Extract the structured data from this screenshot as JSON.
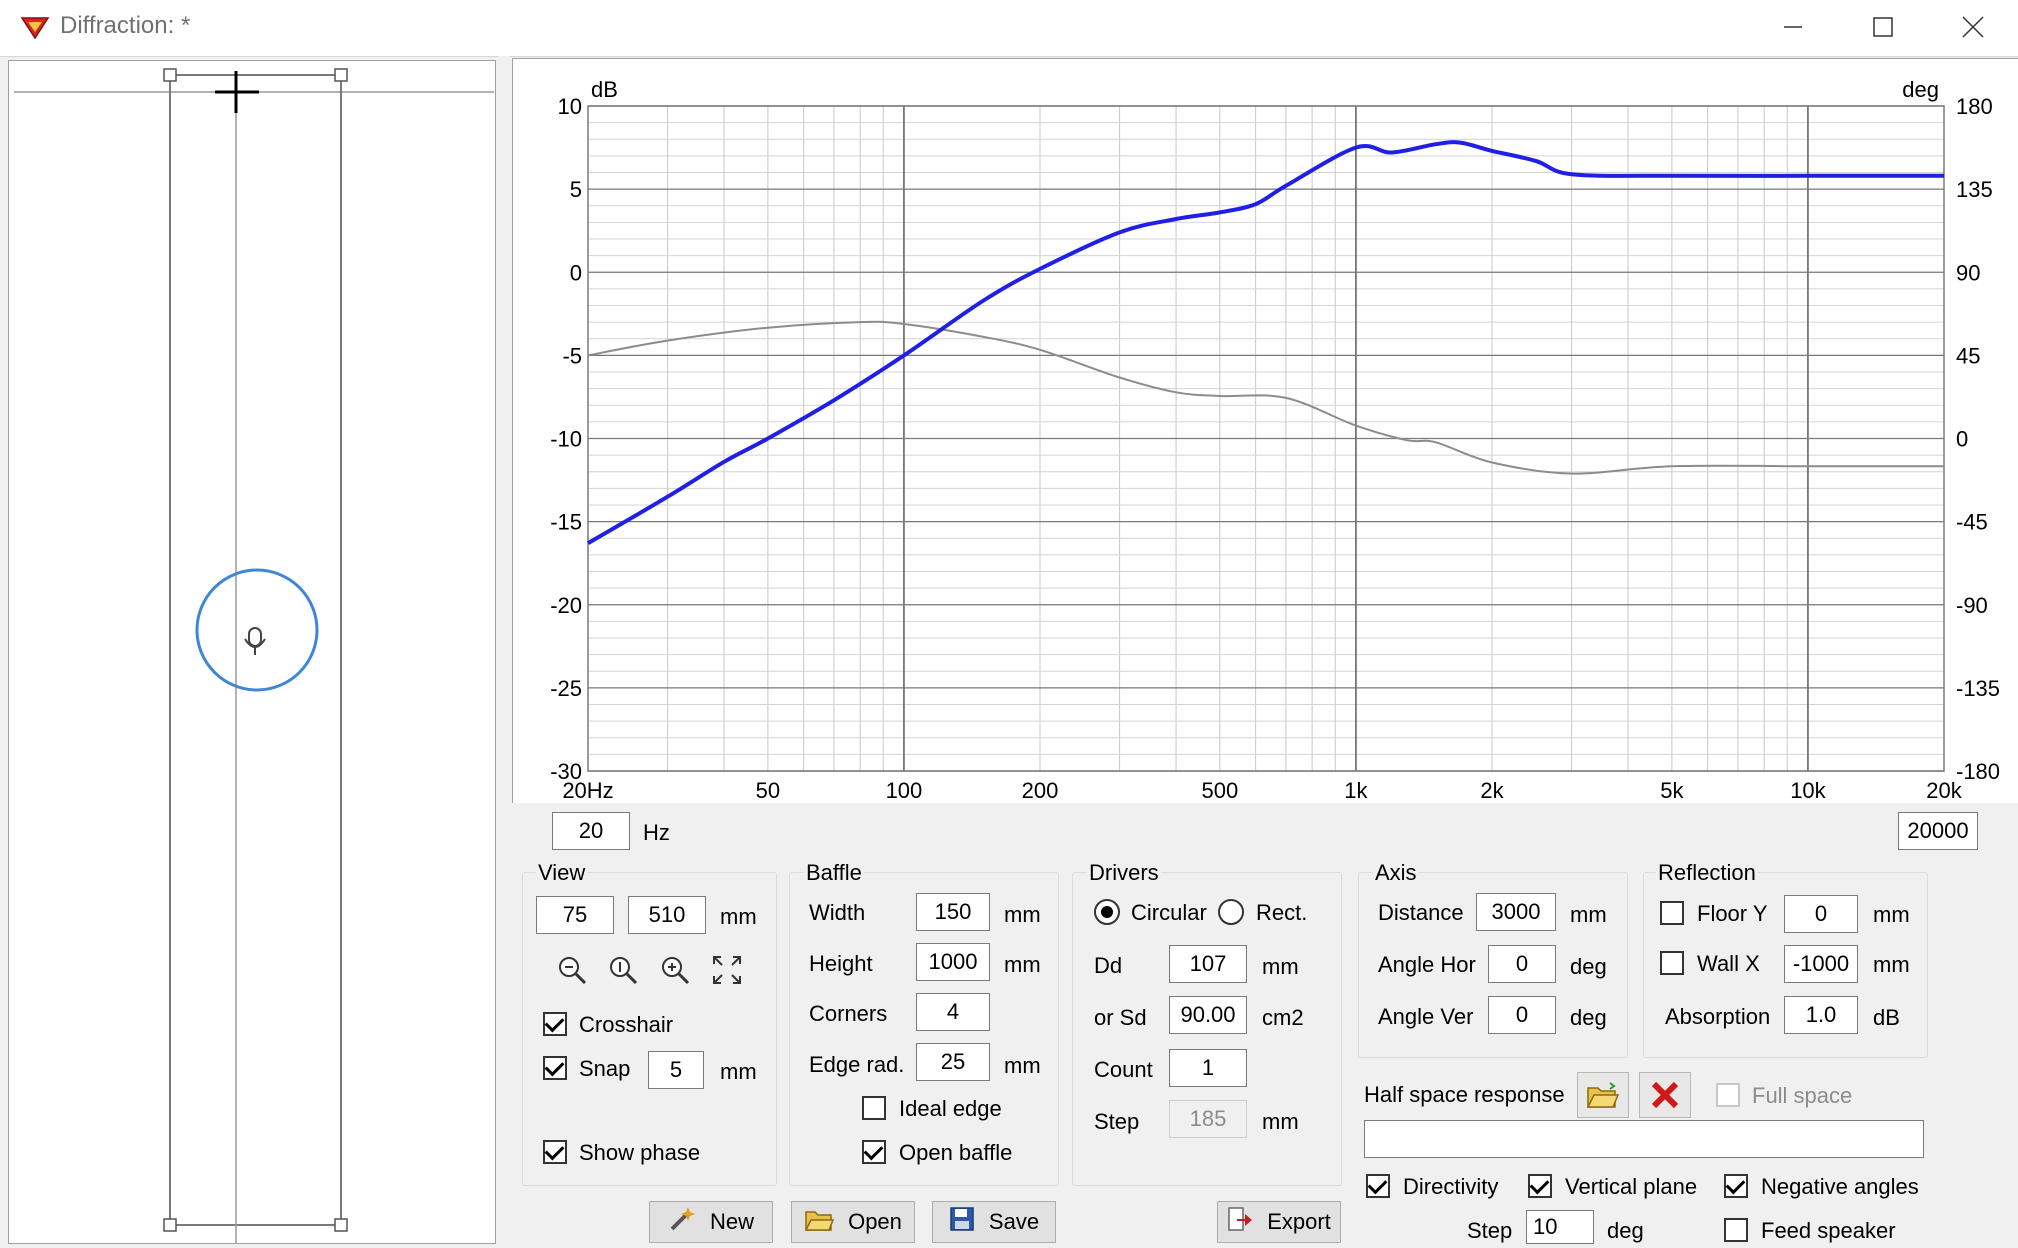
{
  "window": {
    "title": "Diffraction: *"
  },
  "chart_data": {
    "type": "line",
    "x_scale": "log",
    "xlim": [
      20,
      20000
    ],
    "x_ticks": [
      "20Hz",
      "50",
      "100",
      "200",
      "500",
      "1k",
      "2k",
      "5k",
      "10k",
      "20k"
    ],
    "y_left_label": "dB",
    "y_left_ticks": [
      "10",
      "5",
      "0",
      "-5",
      "-10",
      "-15",
      "-20",
      "-25",
      "-30"
    ],
    "ylim_left": [
      -30,
      10
    ],
    "y_right_label": "deg",
    "y_right_ticks": [
      "180",
      "135",
      "90",
      "45",
      "0",
      "-45",
      "-90",
      "-135",
      "-180"
    ],
    "ylim_right": [
      -180,
      180
    ],
    "grid": true,
    "series": [
      {
        "axis": "left",
        "color": "#1f1fe6",
        "x": [
          20,
          30,
          40,
          50,
          70,
          100,
          150,
          200,
          300,
          400,
          500,
          600,
          700,
          1000,
          1200,
          1500,
          1700,
          2000,
          2500,
          3000,
          5000,
          10000,
          20000
        ],
        "y": [
          -16.3,
          -13.5,
          -11.4,
          -10.0,
          -7.7,
          -5.0,
          -1.7,
          0.2,
          2.4,
          3.2,
          3.6,
          4.1,
          5.2,
          7.5,
          7.2,
          7.7,
          7.8,
          7.3,
          6.7,
          5.9,
          5.8,
          5.8,
          5.8
        ]
      },
      {
        "axis": "right",
        "color": "#8c8c8c",
        "x": [
          20,
          30,
          50,
          80,
          100,
          150,
          200,
          300,
          400,
          500,
          700,
          1000,
          1300,
          1500,
          2000,
          3000,
          5000,
          10000,
          20000
        ],
        "y": [
          45,
          53,
          60,
          63,
          62,
          55,
          48,
          33,
          25,
          23,
          22,
          7,
          -1,
          -2,
          -13,
          -19,
          -15,
          -15,
          -15
        ]
      }
    ]
  },
  "freq_min": {
    "value": "20",
    "unit": "Hz"
  },
  "freq_max": {
    "value": "20000"
  },
  "view": {
    "title": "View",
    "x": "75",
    "y": "510",
    "unit": "mm",
    "crosshair_label": "Crosshair",
    "crosshair_checked": true,
    "snap_label": "Snap",
    "snap_value": "5",
    "snap_unit": "mm",
    "snap_checked": true,
    "show_phase_label": "Show phase",
    "show_phase_checked": true
  },
  "baffle": {
    "title": "Baffle",
    "width_label": "Width",
    "width": "150",
    "width_unit": "mm",
    "height_label": "Height",
    "height": "1000",
    "height_unit": "mm",
    "corners_label": "Corners",
    "corners": "4",
    "edge_label": "Edge rad.",
    "edge": "25",
    "edge_unit": "mm",
    "ideal_edge_label": "Ideal edge",
    "ideal_edge_checked": false,
    "open_baffle_label": "Open baffle",
    "open_baffle_checked": true
  },
  "drivers": {
    "title": "Drivers",
    "circular_label": "Circular",
    "rect_label": "Rect.",
    "dd_label": "Dd",
    "dd": "107",
    "dd_unit": "mm",
    "sd_label": "or Sd",
    "sd": "90.00",
    "sd_unit": "cm2",
    "count_label": "Count",
    "count": "1",
    "step_label": "Step",
    "step": "185",
    "step_unit": "mm"
  },
  "axis": {
    "title": "Axis",
    "distance_label": "Distance",
    "distance": "3000",
    "distance_unit": "mm",
    "angle_hor_label": "Angle Hor",
    "angle_hor": "0",
    "angle_hor_unit": "deg",
    "angle_ver_label": "Angle Ver",
    "angle_ver": "0",
    "angle_ver_unit": "deg"
  },
  "reflection": {
    "title": "Reflection",
    "floor_label": "Floor Y",
    "floor": "0",
    "floor_unit": "mm",
    "floor_checked": false,
    "wall_label": "Wall  X",
    "wall": "-1000",
    "wall_unit": "mm",
    "wall_checked": false,
    "absorption_label": "Absorption",
    "absorption": "1.0",
    "absorption_unit": "dB"
  },
  "half_space": {
    "label": "Half space response",
    "file": "",
    "full_space_label": "Full space",
    "full_space_checked": false,
    "directivity_label": "Directivity",
    "directivity_checked": true,
    "vertical_plane_label": "Vertical plane",
    "vertical_plane_checked": true,
    "negative_angles_label": "Negative angles",
    "negative_angles_checked": true,
    "step_label": "Step",
    "step": "10",
    "step_unit": "deg",
    "feed_speaker_label": "Feed speaker",
    "feed_speaker_checked": false
  },
  "buttons": {
    "new": "New",
    "open": "Open",
    "save": "Save",
    "export": "Export"
  }
}
